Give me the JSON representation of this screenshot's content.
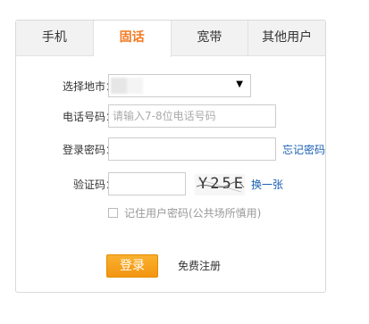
{
  "tabs": [
    {
      "label": "手机"
    },
    {
      "label": "固话"
    },
    {
      "label": "宽带"
    },
    {
      "label": "其他用户"
    }
  ],
  "active_tab": "固话",
  "accent_color": "#f47920",
  "link_color": "#1a5fb4",
  "form": {
    "city_label": "选择地市：",
    "phone_label": "电话号码：",
    "phone_placeholder": "请输入7-8位电话号码",
    "password_label": "登录密码：",
    "password_value": "",
    "forgot_link": "忘记密码",
    "captcha_label": "验证码：",
    "captcha_value": "",
    "captcha_text": "Y25E",
    "refresh_link": "换一张",
    "remember_label": "记住用户密码(公共场所慎用)",
    "login_label": "登录",
    "register_label": "免费注册"
  }
}
